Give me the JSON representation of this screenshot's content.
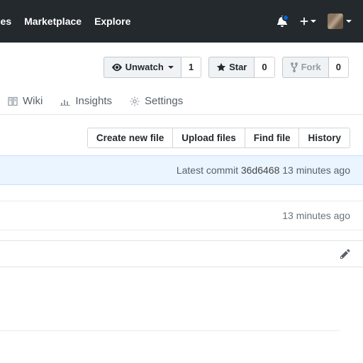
{
  "topnav": {
    "item1": "ues",
    "item2": "Marketplace",
    "item3": "Explore"
  },
  "repoActions": {
    "unwatch": "Unwatch",
    "unwatchCount": "1",
    "star": "Star",
    "starCount": "0",
    "fork": "Fork",
    "forkCount": "0"
  },
  "tabs": {
    "wiki": "Wiki",
    "insights": "Insights",
    "settings": "Settings"
  },
  "fileActions": {
    "create": "Create new file",
    "upload": "Upload files",
    "find": "Find file",
    "history": "History"
  },
  "commit": {
    "prefix": "Latest commit",
    "hash": "36d6468",
    "time": "13 minutes ago"
  },
  "fileRow": {
    "time": "13 minutes ago"
  }
}
